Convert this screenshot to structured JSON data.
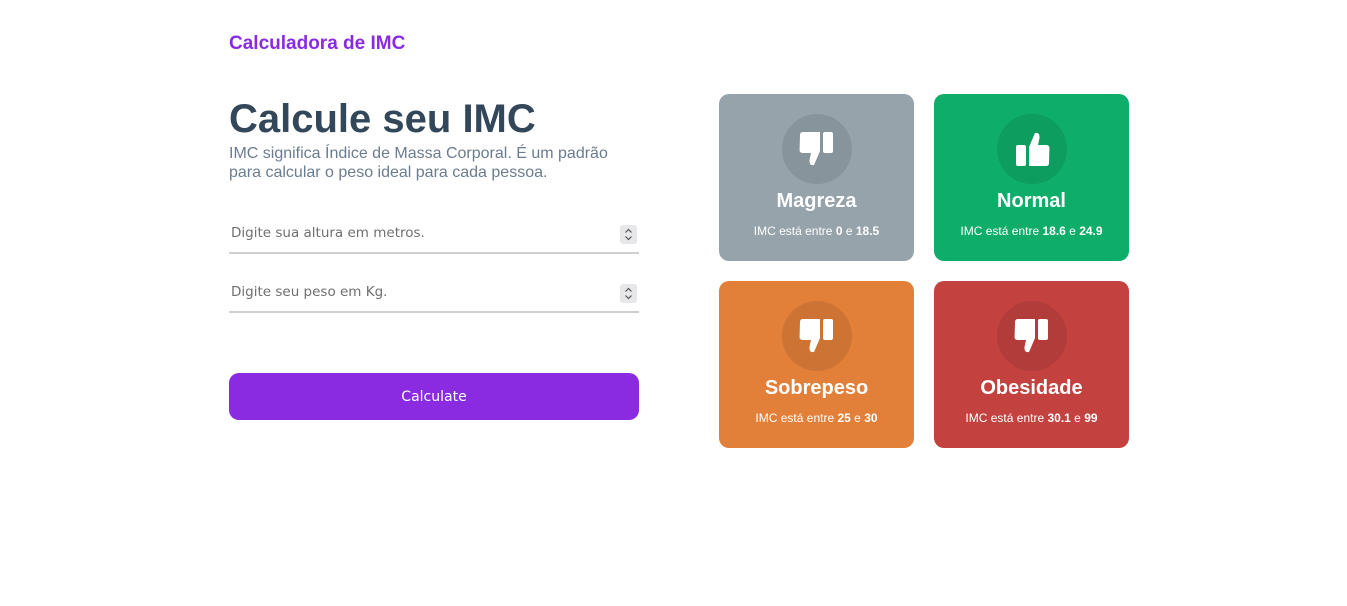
{
  "header": {
    "brand": "Calculadora de IMC"
  },
  "intro": {
    "title": "Calcule seu IMC",
    "subtitle_line1": "IMC significa Índice de Massa Corporal. É um padrão",
    "subtitle_line2": "para calcular o peso ideal para cada pessoa."
  },
  "form": {
    "height_placeholder": "Digite sua altura em metros.",
    "weight_placeholder": "Digite seu peso em Kg.",
    "submit_label": "Calculate"
  },
  "categories": [
    {
      "title": "Magreza",
      "prefix": "IMC está entre",
      "min": "0",
      "connector": "e",
      "max": "18.5",
      "color": "#96a3ab",
      "icon": "thumbs-down-icon"
    },
    {
      "title": "Normal",
      "prefix": "IMC está entre",
      "min": "18.6",
      "connector": "e",
      "max": "24.9",
      "color": "#0ead69",
      "icon": "thumbs-up-icon"
    },
    {
      "title": "Sobrepeso",
      "prefix": "IMC está entre",
      "min": "25",
      "connector": "e",
      "max": "30",
      "color": "#e2803a",
      "icon": "thumbs-down-icon"
    },
    {
      "title": "Obesidade",
      "prefix": "IMC está entre",
      "min": "30.1",
      "connector": "e",
      "max": "99",
      "color": "#c3423f",
      "icon": "thumbs-down-icon"
    }
  ]
}
